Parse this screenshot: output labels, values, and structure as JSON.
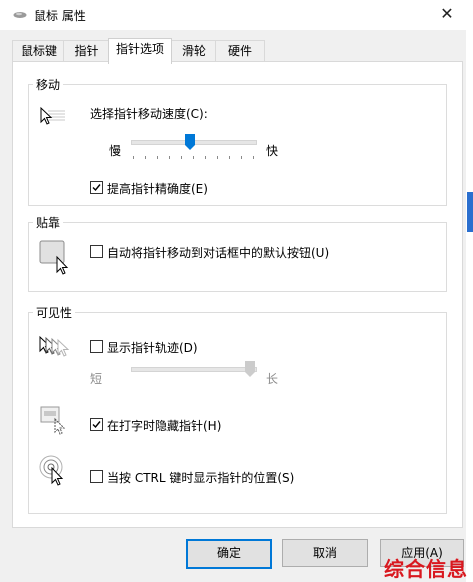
{
  "window": {
    "title": "鼠标 属性",
    "close_glyph": "✕"
  },
  "tabs": [
    {
      "label": "鼠标键"
    },
    {
      "label": "指针"
    },
    {
      "label": "指针选项"
    },
    {
      "label": "滑轮"
    },
    {
      "label": "硬件"
    }
  ],
  "active_tab": "指针选项",
  "motion": {
    "group_title": "移动",
    "speed_label": "选择指针移动速度(C):",
    "slow_label": "慢",
    "fast_label": "快",
    "speed_value": 10,
    "speed_min": 1,
    "speed_max": 20,
    "precision_label": "提高指针精确度(E)",
    "precision_checked": true
  },
  "snap": {
    "group_title": "贴靠",
    "snap_label": "自动将指针移动到对话框中的默认按钮(U)",
    "snap_checked": false
  },
  "visibility": {
    "group_title": "可见性",
    "trails_label": "显示指针轨迹(D)",
    "trails_checked": false,
    "short_label": "短",
    "long_label": "长",
    "trail_value": 1,
    "hide_label": "在打字时隐藏指针(H)",
    "hide_checked": true,
    "ctrl_label": "当按 CTRL 键时显示指针的位置(S)",
    "ctrl_checked": false
  },
  "buttons": {
    "ok": "确定",
    "cancel": "取消",
    "apply": "应用(A)"
  },
  "watermark": "综合信息",
  "colors": {
    "accent": "#0078d7",
    "watermark": "#d9181f"
  }
}
